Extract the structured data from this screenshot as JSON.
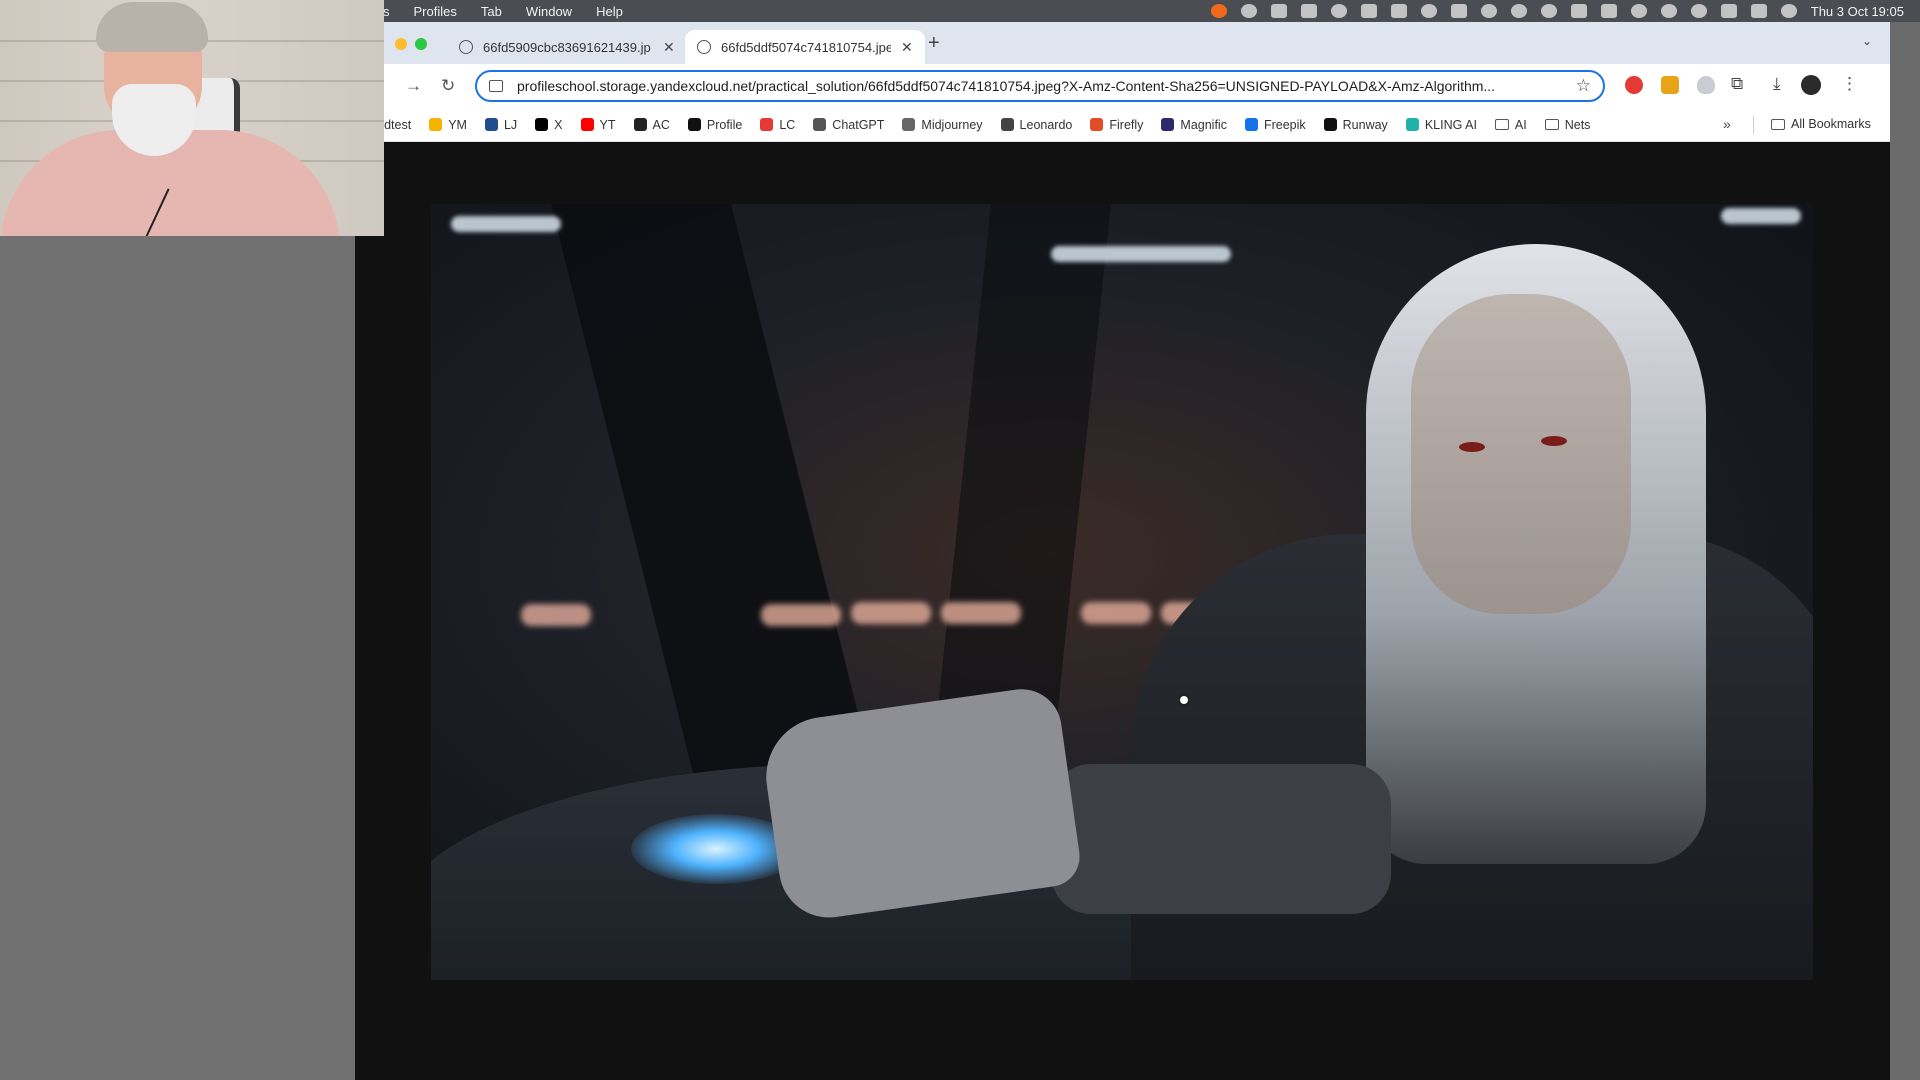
{
  "menubar": {
    "items": [
      "s",
      "Profiles",
      "Tab",
      "Window",
      "Help"
    ],
    "clock": "Thu 3 Oct  19:05"
  },
  "tabs": [
    {
      "title": "66fd5909cbc83691621439.jp",
      "active": false
    },
    {
      "title": "66fd5ddf5074c741810754.jpe",
      "active": true
    }
  ],
  "toolbar": {
    "url": "profileschool.storage.yandexcloud.net/practical_solution/66fd5ddf5074c741810754.jpeg?X-Amz-Content-Sha256=UNSIGNED-PAYLOAD&X-Amz-Algorithm..."
  },
  "bookmarks": [
    {
      "label": "speedtest",
      "icon": "speedtest-icon",
      "color": "#ffffff"
    },
    {
      "label": "YM",
      "icon": "mail-icon",
      "color": "#f5b400"
    },
    {
      "label": "LJ",
      "icon": "lj-icon",
      "color": "#1e4e8c"
    },
    {
      "label": "X",
      "icon": "x-icon",
      "color": "#000000"
    },
    {
      "label": "YT",
      "icon": "youtube-icon",
      "color": "#ff0000"
    },
    {
      "label": "AC",
      "icon": "ac-icon",
      "color": "#222222"
    },
    {
      "label": "Profile",
      "icon": "profile-icon",
      "color": "#111111"
    },
    {
      "label": "LC",
      "icon": "lc-icon",
      "color": "#e53935"
    },
    {
      "label": "ChatGPT",
      "icon": "chatgpt-icon",
      "color": "#555555"
    },
    {
      "label": "Midjourney",
      "icon": "midjourney-icon",
      "color": "#666666"
    },
    {
      "label": "Leonardo",
      "icon": "leonardo-icon",
      "color": "#444444"
    },
    {
      "label": "Firefly",
      "icon": "firefly-icon",
      "color": "#e34b2a"
    },
    {
      "label": "Magnific",
      "icon": "magnific-icon",
      "color": "#2b2b6b"
    },
    {
      "label": "Freepik",
      "icon": "freepik-icon",
      "color": "#1273eb"
    },
    {
      "label": "Runway",
      "icon": "runway-icon",
      "color": "#111111"
    },
    {
      "label": "KLING AI",
      "icon": "kling-icon",
      "color": "#20b2aa"
    },
    {
      "label": "AI",
      "icon": "folder-icon",
      "color": "#555555"
    },
    {
      "label": "Nets",
      "icon": "folder-icon",
      "color": "#555555"
    }
  ],
  "bookmarks_all": "All Bookmarks",
  "colors": {
    "accent": "#1a73e8",
    "tabstrip": "#dfe5ef",
    "menubar": "#4a4d52",
    "viewer_bg": "#111111"
  }
}
